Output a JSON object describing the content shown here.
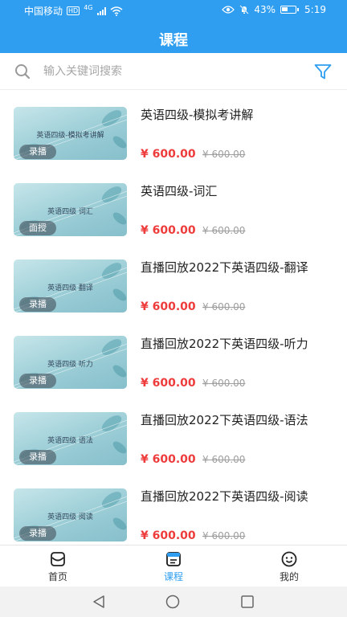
{
  "status_bar": {
    "carrier": "中国移动",
    "hd": "HD",
    "network": "4G",
    "battery": "43%",
    "time": "5:19"
  },
  "header": {
    "title": "课程"
  },
  "search": {
    "placeholder": "输入关键词搜索"
  },
  "courses": [
    {
      "title": "英语四级-模拟考讲解",
      "thumb_caption": "英语四级-模拟考讲解",
      "tag": "录播",
      "price": "¥ 600.00",
      "original_price": "¥ 600.00"
    },
    {
      "title": "英语四级-词汇",
      "thumb_caption": "英语四级 词汇",
      "tag": "面授",
      "price": "¥ 600.00",
      "original_price": "¥ 600.00"
    },
    {
      "title": "直播回放2022下英语四级-翻译",
      "thumb_caption": "英语四级 翻译",
      "tag": "录播",
      "price": "¥ 600.00",
      "original_price": "¥ 600.00"
    },
    {
      "title": "直播回放2022下英语四级-听力",
      "thumb_caption": "英语四级 听力",
      "tag": "录播",
      "price": "¥ 600.00",
      "original_price": "¥ 600.00"
    },
    {
      "title": "直播回放2022下英语四级-语法",
      "thumb_caption": "英语四级 语法",
      "tag": "录播",
      "price": "¥ 600.00",
      "original_price": "¥ 600.00"
    },
    {
      "title": "直播回放2022下英语四级-阅读",
      "thumb_caption": "英语四级 阅读",
      "tag": "录播",
      "price": "¥ 600.00",
      "original_price": "¥ 600.00"
    }
  ],
  "tabs": [
    {
      "label": "首页",
      "icon": "home-icon",
      "active": false
    },
    {
      "label": "课程",
      "icon": "course-icon",
      "active": true
    },
    {
      "label": "我的",
      "icon": "profile-icon",
      "active": false
    }
  ],
  "colors": {
    "primary": "#2f9ef0",
    "price": "#ee3b3b",
    "muted": "#9e9e9e"
  }
}
